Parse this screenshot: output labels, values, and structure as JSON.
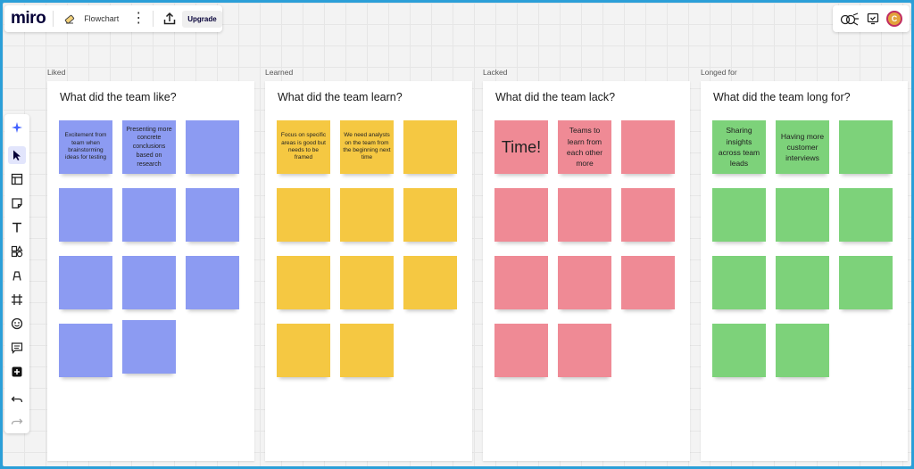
{
  "app": {
    "logo": "miro",
    "board_name": "Flowchart",
    "upgrade_label": "Upgrade",
    "avatar_initial": "C"
  },
  "colors": {
    "frame": "#2b9fd8",
    "liked": "#8c9bf2",
    "learned": "#f5c842",
    "lacked": "#ef8a95",
    "longed": "#7dd27a"
  },
  "toolbar_icons": [
    "sparkle-icon",
    "cursor-icon",
    "templates-icon",
    "sticky-note-icon",
    "text-icon",
    "shapes-icon",
    "pen-icon",
    "frame-icon",
    "emoji-icon",
    "comment-icon",
    "add-icon",
    "undo-icon",
    "redo-icon"
  ],
  "columns": [
    {
      "label": "Liked",
      "title": "What did the team like?",
      "notes": [
        "Excitement from team when brainstorming ideas for testing",
        "Presenting more concrete conclusions based on research",
        "",
        "",
        "",
        "",
        "",
        "",
        "",
        "",
        ""
      ]
    },
    {
      "label": "Learned",
      "title": "What did the team learn?",
      "notes": [
        "Focus on specific areas is good but needs to be framed",
        "We need analysts on the team from the beginning next time",
        "",
        "",
        "",
        "",
        "",
        "",
        "",
        "",
        ""
      ]
    },
    {
      "label": "Lacked",
      "title": "What did the team lack?",
      "notes": [
        "Time!",
        "Teams to learn from each other more",
        "",
        "",
        "",
        "",
        "",
        "",
        "",
        "",
        ""
      ]
    },
    {
      "label": "Longed for",
      "title": "What did the team long for?",
      "notes": [
        "Sharing insights across team leads",
        "Having more customer interviews",
        "",
        "",
        "",
        "",
        "",
        "",
        "",
        ""
      ]
    }
  ]
}
